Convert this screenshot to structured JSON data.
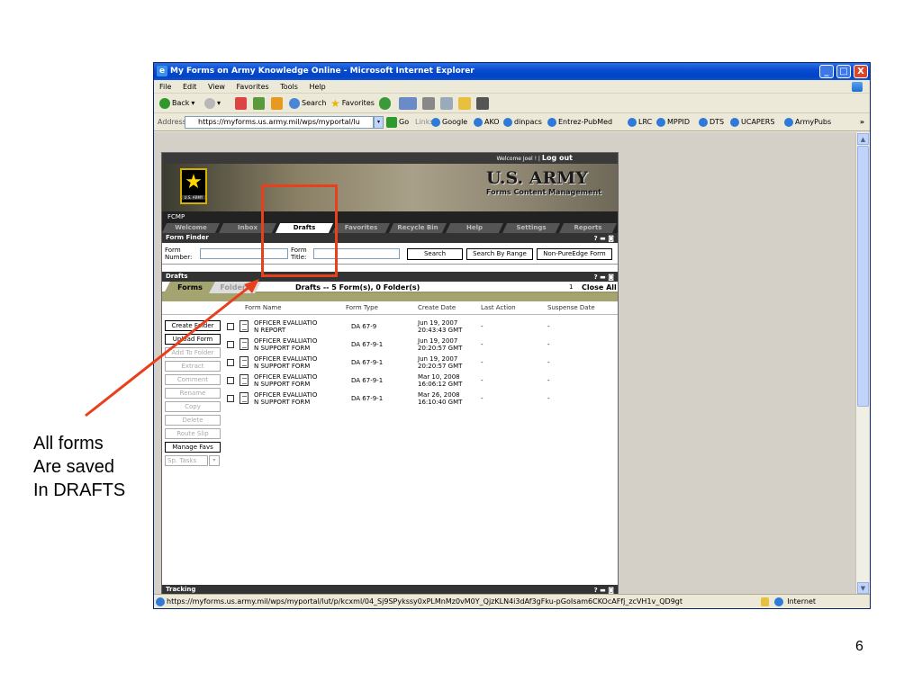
{
  "window": {
    "title": "My Forms on Army Knowledge Online - Microsoft Internet Explorer",
    "min": "_",
    "max": "□",
    "close": "X"
  },
  "menu": {
    "items": [
      "File",
      "Edit",
      "View",
      "Favorites",
      "Tools",
      "Help"
    ]
  },
  "toolbar": {
    "back": "Back",
    "search": "Search",
    "favorites": "Favorites"
  },
  "address": {
    "label": "Address",
    "url": "https://myforms.us.army.mil/wps/myportal/lu",
    "go": "Go",
    "links_label": "Links",
    "links": [
      "Google",
      "AKO",
      "dinpacs",
      "Entrez-PubMed",
      "LRC",
      "MPPID",
      "DTS",
      "UCAPERS",
      "ArmyPubs"
    ],
    "more": "»"
  },
  "status": {
    "url": "https://myforms.us.army.mil/wps/myportal/lut/p/kcxml/04_Sj9SPykssy0xPLMnMz0vM0Y_QjzKLN4i3dAf3gFku-pGoIsam6CKOcAFfj_zcVH1v_QD9gt",
    "zone": "Internet"
  },
  "portal": {
    "welcome": "Welcome Joel ! |",
    "logout": "Log out",
    "logo_text": "U.S. ARMY",
    "brand_title": "U.S. ARMY",
    "brand_subtitle": "Forms Content Management",
    "fcmp": "FCMP",
    "tabs": [
      "Welcome",
      "Inbox",
      "Drafts",
      "Favorites",
      "Recycle Bin",
      "Help",
      "Settings",
      "Reports"
    ]
  },
  "form_finder": {
    "header": "Form Finder",
    "icons": "? ▬ ◙",
    "number_label_1": "Form",
    "number_label_2": "Number:",
    "title_label_1": "Form",
    "title_label_2": "Title:",
    "search": "Search",
    "search_range": "Search By Range",
    "non_pure": "Non-PureEdge Form"
  },
  "drafts": {
    "header": "Drafts",
    "icons": "? ▬ ◙",
    "tab_forms": "Forms",
    "tab_folders": "Folders",
    "summary": "Drafts -- 5 Form(s), 0 Folder(s)",
    "page": "1",
    "close_all": "Close All",
    "columns": [
      "Form Name",
      "Form Type",
      "Create Date",
      "Last Action",
      "Suspense Date"
    ],
    "actions": [
      {
        "label": "Create Folder",
        "enabled": true
      },
      {
        "label": "Upload Form",
        "enabled": true
      },
      {
        "label": "Add To Folder",
        "enabled": false
      },
      {
        "label": "Extract",
        "enabled": false
      },
      {
        "label": "Comment",
        "enabled": false
      },
      {
        "label": "Rename",
        "enabled": false
      },
      {
        "label": "Copy",
        "enabled": false
      },
      {
        "label": "Delete",
        "enabled": false
      },
      {
        "label": "Route Slip",
        "enabled": false
      },
      {
        "label": "Manage Favs",
        "enabled": true
      },
      {
        "label": "Sp. Tasks",
        "enabled": false
      }
    ],
    "rows": [
      {
        "name1": "OFFICER EVALUATIO",
        "name2": "N REPORT",
        "type": "DA 67-9",
        "date1": "Jun 19, 2007",
        "date2": "20:43:43 GMT",
        "last": "-",
        "susp": "-"
      },
      {
        "name1": "OFFICER EVALUATIO",
        "name2": "N SUPPORT FORM",
        "type": "DA 67-9-1",
        "date1": "Jun 19, 2007",
        "date2": "20:20:57 GMT",
        "last": "-",
        "susp": "-"
      },
      {
        "name1": "OFFICER EVALUATIO",
        "name2": "N SUPPORT FORM",
        "type": "DA 67-9-1",
        "date1": "Jun 19, 2007",
        "date2": "20:20:57 GMT",
        "last": "-",
        "susp": "-"
      },
      {
        "name1": "OFFICER EVALUATIO",
        "name2": "N SUPPORT FORM",
        "type": "DA 67-9-1",
        "date1": "Mar 10, 2008",
        "date2": "16:06:12 GMT",
        "last": "-",
        "susp": "-"
      },
      {
        "name1": "OFFICER EVALUATIO",
        "name2": "N SUPPORT FORM",
        "type": "DA 67-9-1",
        "date1": "Mar 26, 2008",
        "date2": "16:10:40 GMT",
        "last": "-",
        "susp": "-"
      }
    ]
  },
  "tracking": {
    "header": "Tracking"
  },
  "annotation": {
    "lines": [
      "All forms",
      "Are saved",
      "In DRAFTS"
    ],
    "color": "#e8401c"
  },
  "slide": {
    "page_number": "6"
  }
}
